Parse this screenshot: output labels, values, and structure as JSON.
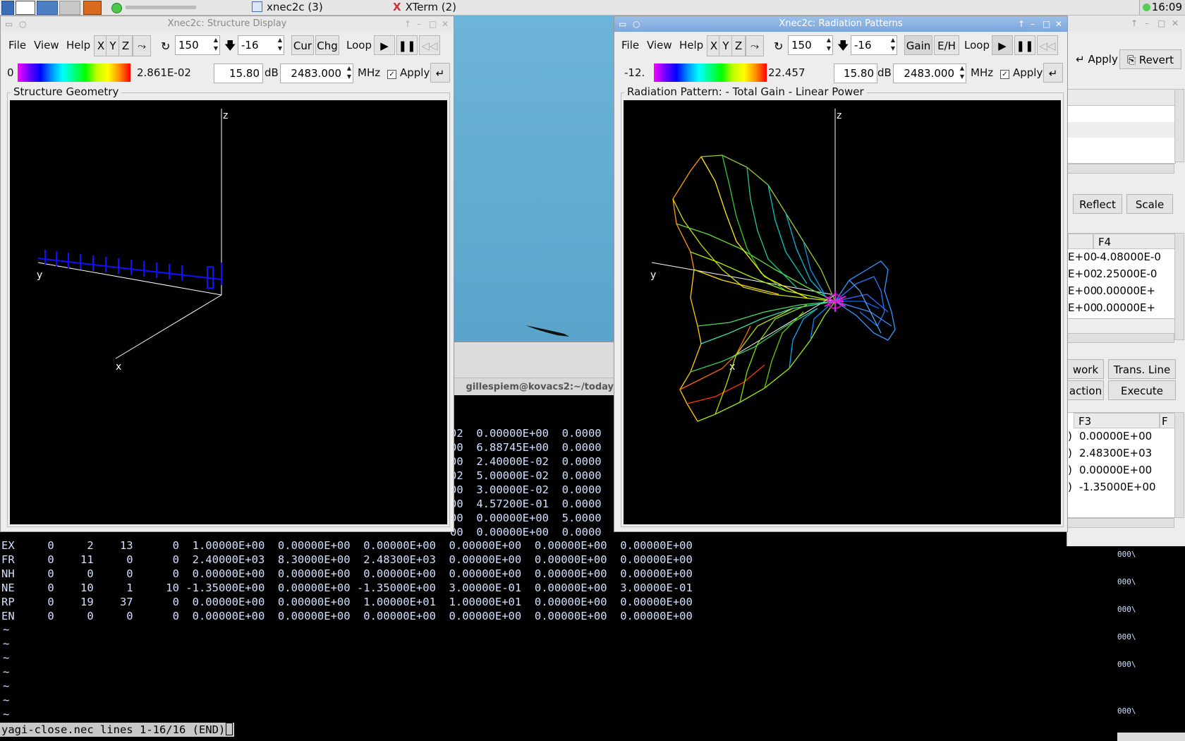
{
  "taskbar": {
    "tasks": [
      "xnec2c (3)",
      "XTerm (2)"
    ],
    "clock": "16:09"
  },
  "bg_window": {
    "title": "gillespiem@kovacs2:~/today"
  },
  "structure_window": {
    "title": "Xnec2c: Structure Display",
    "menu": [
      "File",
      "View",
      "Help"
    ],
    "axis_buttons": [
      "X",
      "Y",
      "Z"
    ],
    "rotate_value": "150",
    "tilt_value": "-16",
    "cur_label": "Cur",
    "chg_label": "Chg",
    "loop_label": "Loop",
    "scale_min": "0",
    "scale_max": "2.861E-02",
    "gain_value": "15.80",
    "db_label": "dB",
    "freq_value": "2483.000",
    "mhz_label": "MHz",
    "apply_label": "Apply",
    "frame_label": "Structure Geometry",
    "axes": {
      "z": "z",
      "y": "y",
      "x": "x"
    }
  },
  "radiation_window": {
    "title": "Xnec2c: Radiation Patterns",
    "menu": [
      "File",
      "View",
      "Help"
    ],
    "axis_buttons": [
      "X",
      "Y",
      "Z"
    ],
    "rotate_value": "150",
    "tilt_value": "-16",
    "gain_label": "Gain",
    "eh_label": "E/H",
    "loop_label": "Loop",
    "scale_min": "-12.",
    "scale_max": "22.457",
    "gain_value": "15.80",
    "db_label": "dB",
    "freq_value": "2483.000",
    "mhz_label": "MHz",
    "apply_label": "Apply",
    "frame_label": "Radiation Pattern: - Total Gain - Linear Power",
    "axes": {
      "z": "z",
      "y": "y",
      "x": "x"
    }
  },
  "right_panel": {
    "apply_label": "Apply",
    "revert_label": "Revert",
    "reflect_label": "Reflect",
    "scale_label": "Scale",
    "table1": {
      "header": "F4",
      "rows": [
        {
          "left": "E+00",
          "value": "-4.08000E-0"
        },
        {
          "left": "E+00",
          "value": "2.25000E-0"
        },
        {
          "left": "E+00",
          "value": "0.00000E+"
        },
        {
          "left": "E+00",
          "value": "0.00000E+"
        }
      ]
    },
    "network_label": "work",
    "transline_label": "Trans. Line",
    "action_label": "action",
    "execute_label": "Execute",
    "table2": {
      "header": "F3",
      "header2": "F",
      "rows": [
        {
          "left": ")",
          "value": "0.00000E+00"
        },
        {
          "left": ")",
          "value": "2.48300E+03"
        },
        {
          "left": ")",
          "value": "0.00000E+00"
        },
        {
          "left": ")",
          "value": "-1.35000E+00"
        }
      ]
    }
  },
  "terminal": {
    "partial_lines": [
      "02  0.00000E+00  0.0000",
      "00  6.88745E+00  0.0000",
      "00  2.40000E-02  0.0000",
      "02  5.00000E-02  0.0000",
      "00  3.00000E-02  0.0000",
      "00  4.57200E-01  0.0000",
      "00  0.00000E+00  5.0000",
      "00  0.00000E+00  0.0000"
    ],
    "lines": [
      "EX     0     2    13      0  1.00000E+00  0.00000E+00  0.00000E+00  0.00000E+00  0.00000E+00  0.00000E+00",
      "FR     0    11     0      0  2.40000E+03  8.30000E+00  2.48300E+03  0.00000E+00  0.00000E+00  0.00000E+00",
      "NH     0     0     0      0  0.00000E+00  0.00000E+00  0.00000E+00  0.00000E+00  0.00000E+00  0.00000E+00",
      "NE     0    10     1     10 -1.35000E+00  0.00000E+00 -1.35000E+00  3.00000E-01  0.00000E+00  3.00000E-01",
      "RP     0    19    37      0  0.00000E+00  0.00000E+00  1.00000E+01  1.00000E+01  0.00000E+00  0.00000E+00",
      "EN     0     0     0      0  0.00000E+00  0.00000E+00  0.00000E+00  0.00000E+00  0.00000E+00  0.00000E+00"
    ],
    "tilde": "~",
    "side_marker": "000\\",
    "status": "yagi-close.nec lines 1-16/16 (END)"
  }
}
